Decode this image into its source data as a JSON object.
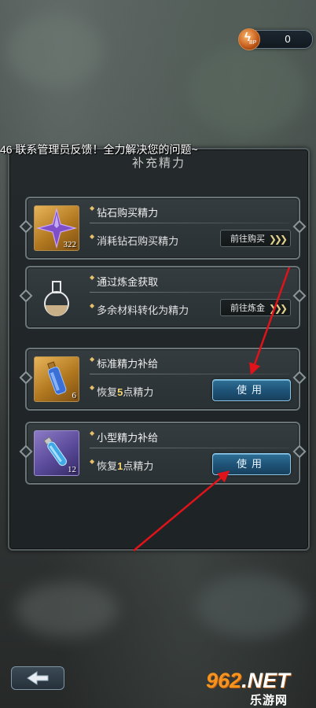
{
  "hud": {
    "energy_label": "BP",
    "energy_value": "0"
  },
  "marquee": "46 联系管理员反馈！全力解决您的问题~",
  "panel": {
    "title": "补充精力"
  },
  "cards": [
    {
      "title": "钻石购买精力",
      "desc": "消耗钻石购买精力",
      "button": "前往购买",
      "count": "322"
    },
    {
      "title": "通过炼金获取",
      "desc": "多余材料转化为精力",
      "button": "前往炼金"
    },
    {
      "title": "标准精力补给",
      "desc_pre": "恢复",
      "desc_num": "5",
      "desc_post": "点精力",
      "button": "使用",
      "count": "6"
    },
    {
      "title": "小型精力补给",
      "desc_pre": "恢复",
      "desc_num": "1",
      "desc_post": "点精力",
      "button": "使用",
      "count": "12"
    }
  ],
  "watermark": {
    "brand": "962",
    "suffix": ".NET",
    "site": "乐游网"
  },
  "colors": {
    "accent_gold": "#f3d36b",
    "button_blue": "#1f5478",
    "arrow_red": "#e0121a"
  }
}
